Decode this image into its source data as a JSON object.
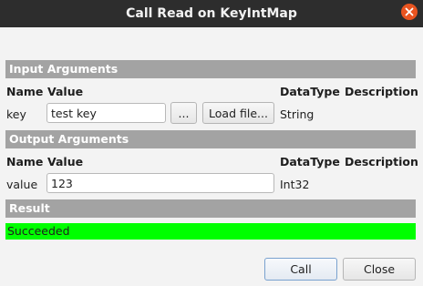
{
  "window": {
    "title": "Call Read on KeyIntMap",
    "close_icon": "close-icon",
    "close_color": "#e95420"
  },
  "input_arguments": {
    "header": "Input Arguments",
    "columns": {
      "name": "Name",
      "value": "Value",
      "datatype": "DataType",
      "description": "Description"
    },
    "rows": [
      {
        "name": "key",
        "value": "test key",
        "browse_label": "...",
        "load_file_label": "Load file...",
        "datatype": "String",
        "description": ""
      }
    ]
  },
  "output_arguments": {
    "header": "Output Arguments",
    "columns": {
      "name": "Name",
      "value": "Value",
      "datatype": "DataType",
      "description": "Description"
    },
    "rows": [
      {
        "name": "value",
        "value": "123",
        "datatype": "Int32",
        "description": ""
      }
    ]
  },
  "result": {
    "header": "Result",
    "status": "Succeeded",
    "status_color": "#00ff00"
  },
  "buttons": {
    "call_label": "Call",
    "close_label": "Close"
  },
  "colors": {
    "section_header_bg": "#a3a3a3",
    "titlebar_bg": "#2d2d2d"
  }
}
